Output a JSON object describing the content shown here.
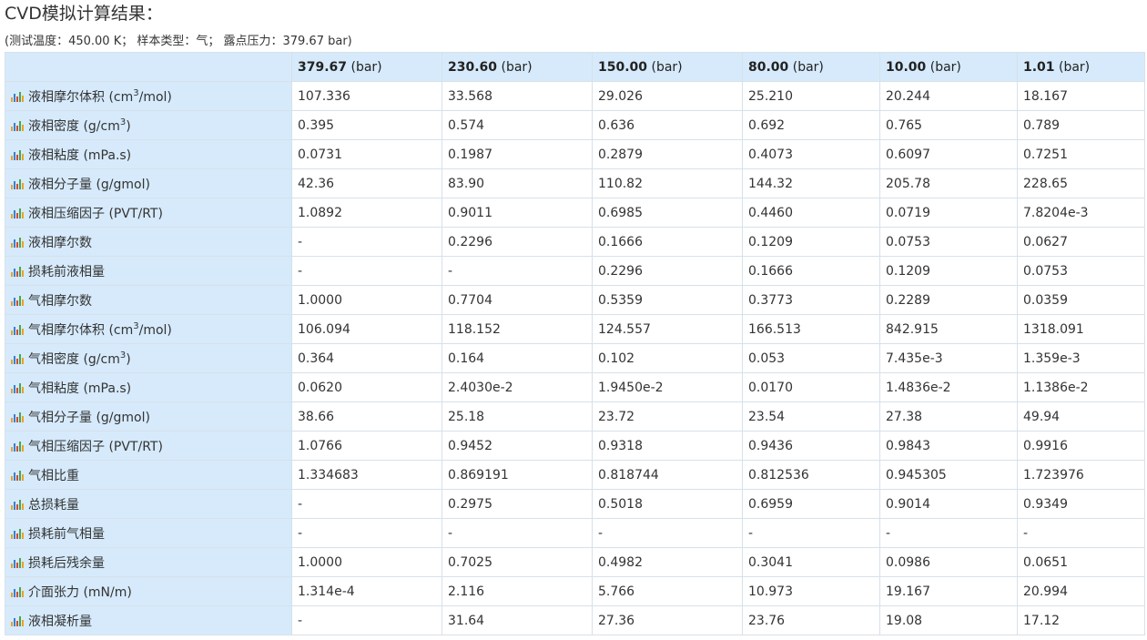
{
  "title": "CVD模拟计算结果：",
  "subtitle": "(测试温度：450.00 K； 样本类型：气； 露点压力：379.67 bar)",
  "table": {
    "pressure_unit": "(bar)",
    "pressures": [
      "379.67",
      "230.60",
      "150.00",
      "80.00",
      "10.00",
      "1.01"
    ],
    "row_icon": "bar-chart-icon",
    "rows": [
      {
        "label": "液相摩尔体积 (cm",
        "sup": "3",
        "label_tail": "/mol)",
        "values": [
          "107.336",
          "33.568",
          "29.026",
          "25.210",
          "20.244",
          "18.167"
        ]
      },
      {
        "label": "液相密度 (g/cm",
        "sup": "3",
        "label_tail": ")",
        "values": [
          "0.395",
          "0.574",
          "0.636",
          "0.692",
          "0.765",
          "0.789"
        ]
      },
      {
        "label": "液相粘度 (mPa.s)",
        "sup": "",
        "label_tail": "",
        "values": [
          "0.0731",
          "0.1987",
          "0.2879",
          "0.4073",
          "0.6097",
          "0.7251"
        ]
      },
      {
        "label": "液相分子量 (g/gmol)",
        "sup": "",
        "label_tail": "",
        "values": [
          "42.36",
          "83.90",
          "110.82",
          "144.32",
          "205.78",
          "228.65"
        ]
      },
      {
        "label": "液相压缩因子 (PVT/RT)",
        "sup": "",
        "label_tail": "",
        "values": [
          "1.0892",
          "0.9011",
          "0.6985",
          "0.4460",
          "0.0719",
          "7.8204e-3"
        ]
      },
      {
        "label": "液相摩尔数",
        "sup": "",
        "label_tail": "",
        "values": [
          "-",
          "0.2296",
          "0.1666",
          "0.1209",
          "0.0753",
          "0.0627"
        ]
      },
      {
        "label": "损耗前液相量",
        "sup": "",
        "label_tail": "",
        "values": [
          "-",
          "-",
          "0.2296",
          "0.1666",
          "0.1209",
          "0.0753"
        ]
      },
      {
        "label": "气相摩尔数",
        "sup": "",
        "label_tail": "",
        "values": [
          "1.0000",
          "0.7704",
          "0.5359",
          "0.3773",
          "0.2289",
          "0.0359"
        ]
      },
      {
        "label": "气相摩尔体积 (cm",
        "sup": "3",
        "label_tail": "/mol)",
        "values": [
          "106.094",
          "118.152",
          "124.557",
          "166.513",
          "842.915",
          "1318.091"
        ]
      },
      {
        "label": "气相密度 (g/cm",
        "sup": "3",
        "label_tail": ")",
        "values": [
          "0.364",
          "0.164",
          "0.102",
          "0.053",
          "7.435e-3",
          "1.359e-3"
        ]
      },
      {
        "label": "气相粘度 (mPa.s)",
        "sup": "",
        "label_tail": "",
        "values": [
          "0.0620",
          "2.4030e-2",
          "1.9450e-2",
          "0.0170",
          "1.4836e-2",
          "1.1386e-2"
        ]
      },
      {
        "label": "气相分子量 (g/gmol)",
        "sup": "",
        "label_tail": "",
        "values": [
          "38.66",
          "25.18",
          "23.72",
          "23.54",
          "27.38",
          "49.94"
        ]
      },
      {
        "label": "气相压缩因子 (PVT/RT)",
        "sup": "",
        "label_tail": "",
        "values": [
          "1.0766",
          "0.9452",
          "0.9318",
          "0.9436",
          "0.9843",
          "0.9916"
        ]
      },
      {
        "label": "气相比重",
        "sup": "",
        "label_tail": "",
        "values": [
          "1.334683",
          "0.869191",
          "0.818744",
          "0.812536",
          "0.945305",
          "1.723976"
        ]
      },
      {
        "label": "总损耗量",
        "sup": "",
        "label_tail": "",
        "values": [
          "-",
          "0.2975",
          "0.5018",
          "0.6959",
          "0.9014",
          "0.9349"
        ]
      },
      {
        "label": "损耗前气相量",
        "sup": "",
        "label_tail": "",
        "values": [
          "-",
          "-",
          "-",
          "-",
          "-",
          "-"
        ]
      },
      {
        "label": "损耗后残余量",
        "sup": "",
        "label_tail": "",
        "values": [
          "1.0000",
          "0.7025",
          "0.4982",
          "0.3041",
          "0.0986",
          "0.0651"
        ]
      },
      {
        "label": "介面张力 (mN/m)",
        "sup": "",
        "label_tail": "",
        "values": [
          "1.314e-4",
          "2.116",
          "5.766",
          "10.973",
          "19.167",
          "20.994"
        ]
      },
      {
        "label": "液相凝析量",
        "sup": "",
        "label_tail": "",
        "values": [
          "-",
          "31.64",
          "27.36",
          "23.76",
          "19.08",
          "17.12"
        ]
      }
    ]
  }
}
